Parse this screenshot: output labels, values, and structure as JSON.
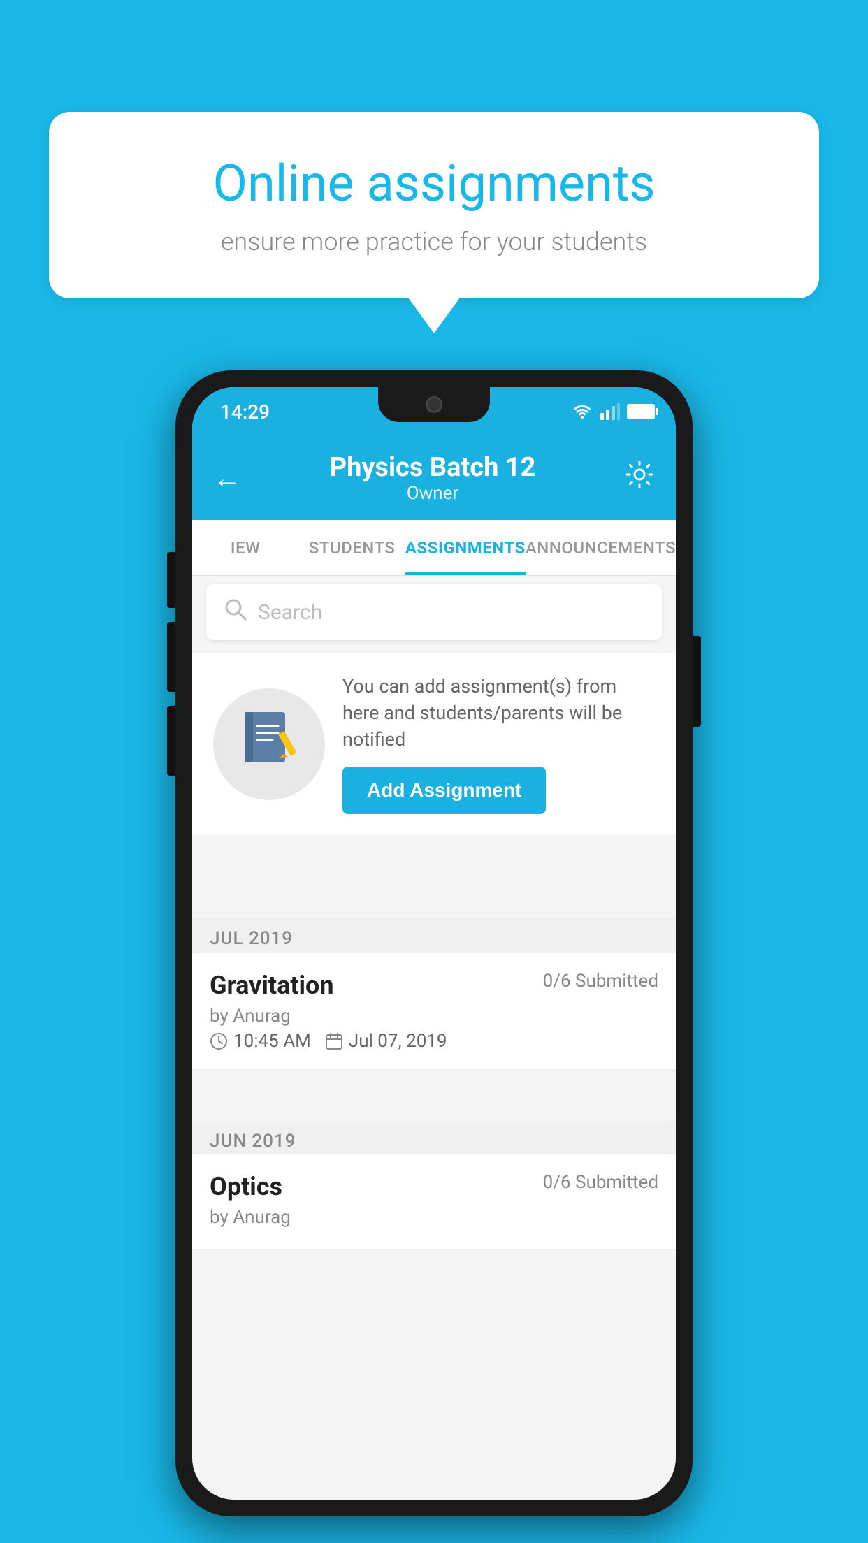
{
  "background_color": "#1ab8e8",
  "speech_bubble": {
    "title": "Online assignments",
    "subtitle": "ensure more practice for your students"
  },
  "status_bar": {
    "time": "14:29"
  },
  "app_header": {
    "title": "Physics Batch 12",
    "subtitle": "Owner"
  },
  "tabs": [
    {
      "label": "IEW",
      "active": false
    },
    {
      "label": "STUDENTS",
      "active": false
    },
    {
      "label": "ASSIGNMENTS",
      "active": true
    },
    {
      "label": "ANNOUNCEMENTS",
      "active": false
    }
  ],
  "search": {
    "placeholder": "Search"
  },
  "promo_card": {
    "description": "You can add assignment(s) from here and students/parents will be notified",
    "button_label": "Add Assignment"
  },
  "month_sections": [
    {
      "label": "JUL 2019",
      "assignments": [
        {
          "title": "Gravitation",
          "submitted": "0/6 Submitted",
          "author": "by Anurag",
          "time": "10:45 AM",
          "date": "Jul 07, 2019"
        }
      ]
    },
    {
      "label": "JUN 2019",
      "assignments": [
        {
          "title": "Optics",
          "submitted": "0/6 Submitted",
          "author": "by Anurag"
        }
      ]
    }
  ]
}
